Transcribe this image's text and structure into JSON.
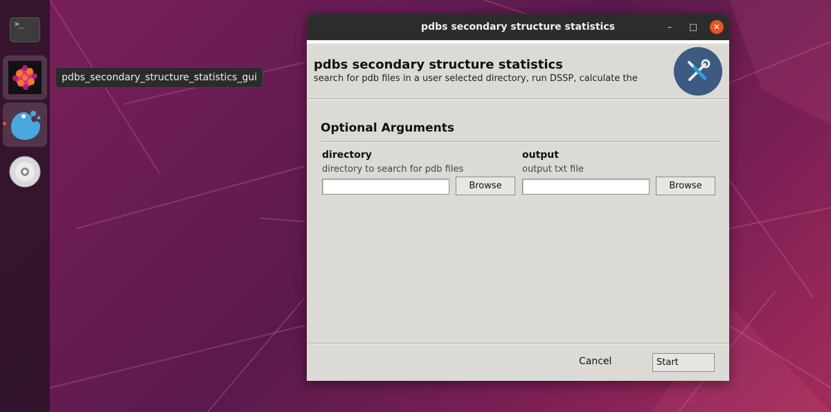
{
  "dock": {
    "items": [
      {
        "name": "terminal",
        "icon": "terminal-icon",
        "glyph": ">_"
      },
      {
        "name": "protein-viewer",
        "icon": "protein-structure-icon"
      },
      {
        "name": "python-app",
        "icon": "python-app-icon"
      },
      {
        "name": "disc",
        "icon": "optical-disc-icon"
      }
    ]
  },
  "tooltip": {
    "text": "pdbs_secondary_structure_statistics_gui"
  },
  "window": {
    "title": "pdbs secondary structure statistics",
    "controls": {
      "minimize": "–",
      "maximize": "□",
      "close": "✕"
    }
  },
  "header": {
    "title": "pdbs secondary structure statistics",
    "description": "search for pdb files in a user selected directory, run DSSP, calculate the",
    "icon": "tools-icon",
    "icon_color": "#3d5a80"
  },
  "section": {
    "title": "Optional Arguments"
  },
  "fields": [
    {
      "label": "directory",
      "help": "directory to search for pdb files",
      "value": "",
      "button": "Browse"
    },
    {
      "label": "output",
      "help": "output txt file",
      "value": "",
      "button": "Browse"
    }
  ],
  "footer": {
    "cancel": "Cancel",
    "start": "Start"
  },
  "colors": {
    "accent": "#e95420",
    "window_bg": "#dcdad5",
    "titlebar": "#2c2c2c"
  }
}
